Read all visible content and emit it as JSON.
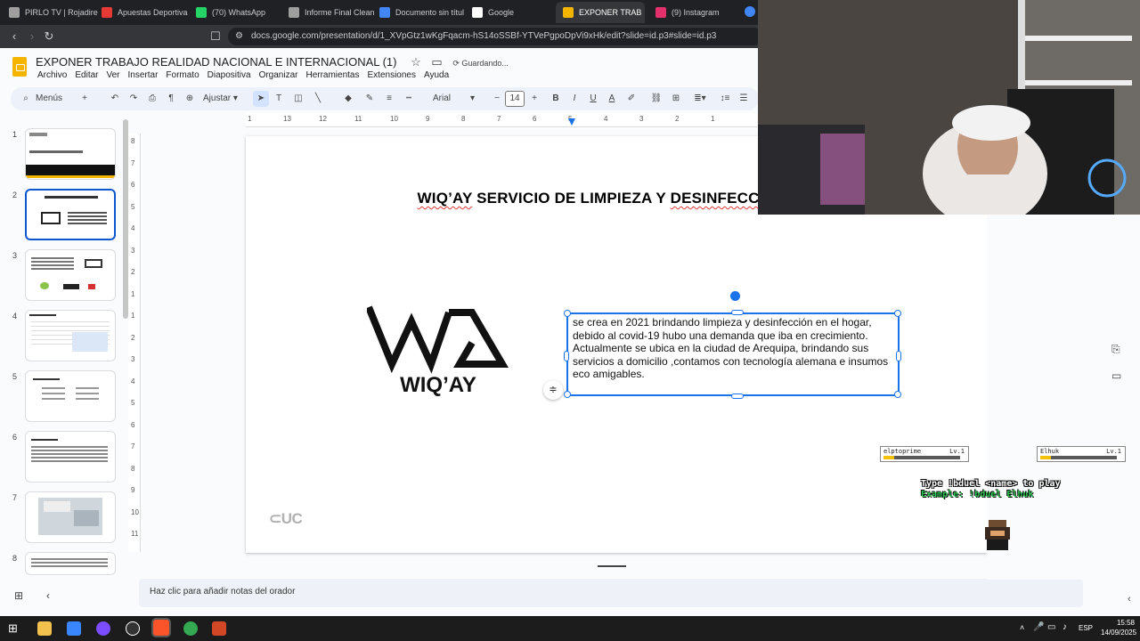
{
  "browser": {
    "tabs": [
      {
        "title": "PIRLO TV | Rojadire",
        "color": "#9e9e9e",
        "active": false
      },
      {
        "title": "Apuestas Deportiva",
        "color": "#e53935",
        "active": false
      },
      {
        "title": "(70) WhatsApp",
        "color": "#25d366",
        "active": false
      },
      {
        "title": "Informe Final Clean",
        "color": "#9e9e9e",
        "active": false
      },
      {
        "title": "Documento sin títul",
        "color": "#4285f4",
        "active": false
      },
      {
        "title": "Google",
        "color": "#ffffff",
        "active": false
      },
      {
        "title": "EXPONER TRAB",
        "color": "#f4b400",
        "active": true
      },
      {
        "title": "(9) Instagram",
        "color": "#e1306c",
        "active": false
      }
    ],
    "url": "docs.google.com/presentation/d/1_XVpGtz1wKgFqacm-hS14oSSBf-YTVePgpoDpVi9xHk/edit?slide=id.p3#slide=id.p3"
  },
  "doc": {
    "title": "EXPONER TRABAJO REALIDAD NACIONAL E INTERNACIONAL (1)",
    "status": "Guardando...",
    "menu": [
      "Archivo",
      "Editar",
      "Ver",
      "Insertar",
      "Formato",
      "Diapositiva",
      "Organizar",
      "Herramientas",
      "Extensiones",
      "Ayuda"
    ]
  },
  "toolbar": {
    "menus_label": "Menús",
    "zoom_label": "Ajustar",
    "font": "Arial",
    "font_size": "14"
  },
  "ruler": {
    "h_ticks": [
      "1",
      "13",
      "12",
      "11",
      "10",
      "9",
      "8",
      "7",
      "6",
      "5",
      "4",
      "3",
      "2",
      "1"
    ],
    "v_ticks": [
      "8",
      "7",
      "6",
      "5",
      "4",
      "3",
      "2",
      "1",
      "1",
      "2",
      "3",
      "4",
      "5",
      "6",
      "7",
      "8",
      "9",
      "10",
      "11"
    ]
  },
  "thumbnails": [
    "1",
    "2",
    "3",
    "4",
    "5",
    "6",
    "7",
    "8"
  ],
  "selected_slide": "2",
  "slide": {
    "title_word1": "WIQ’AY",
    "title_rest": " SERVICIO DE LIMPIEZA Y ",
    "title_word2": "DESINFECCIÓN",
    "body": "se crea en 2021 brindando limpieza y desinfección en el hogar, debido al covid-19 hubo una demanda que iba en crecimiento. Actualmente se ubica en la ciudad de Arequipa, brindando sus servicios a domicilio ,contamos con tecnología alemana e insumos eco amigables.",
    "logo_text": "WIQ’AY",
    "footer_logo": "UC"
  },
  "notes_placeholder": "Haz clic para añadir notas del orador",
  "overlay": {
    "player1": "elptoprime",
    "player2": "Elhuk",
    "level": "Lv.1",
    "hp": "HP",
    "line1": "Type !bduel <name> to play",
    "line2": "Example: !bduel Elhuk"
  },
  "taskbar": {
    "lang": "ESP",
    "time": "15:58",
    "date": "14/09/2025"
  }
}
